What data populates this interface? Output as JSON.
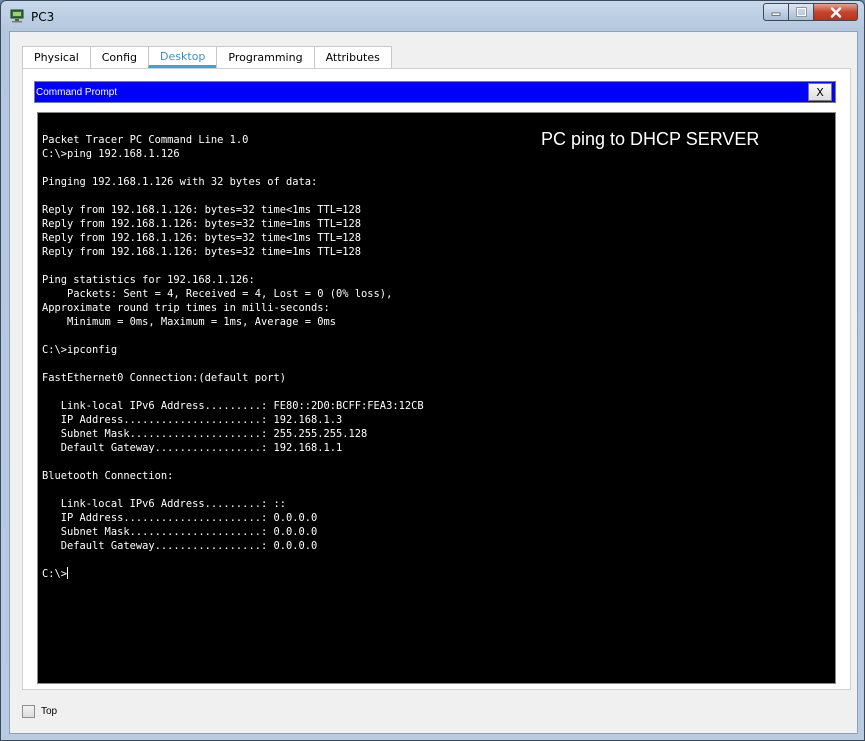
{
  "window": {
    "title": "PC3"
  },
  "tabs": [
    {
      "label": "Physical"
    },
    {
      "label": "Config"
    },
    {
      "label": "Desktop",
      "active": true
    },
    {
      "label": "Programming"
    },
    {
      "label": "Attributes"
    }
  ],
  "command_prompt": {
    "title": "Command Prompt",
    "close_label": "X",
    "annotation": "PC ping to DHCP SERVER",
    "prompt": "C:\\>",
    "lines": [
      "Packet Tracer PC Command Line 1.0",
      "C:\\>ping 192.168.1.126",
      "",
      "Pinging 192.168.1.126 with 32 bytes of data:",
      "",
      "Reply from 192.168.1.126: bytes=32 time<1ms TTL=128",
      "Reply from 192.168.1.126: bytes=32 time=1ms TTL=128",
      "Reply from 192.168.1.126: bytes=32 time<1ms TTL=128",
      "Reply from 192.168.1.126: bytes=32 time=1ms TTL=128",
      "",
      "Ping statistics for 192.168.1.126:",
      "    Packets: Sent = 4, Received = 4, Lost = 0 (0% loss),",
      "Approximate round trip times in milli-seconds:",
      "    Minimum = 0ms, Maximum = 1ms, Average = 0ms",
      "",
      "C:\\>ipconfig",
      "",
      "FastEthernet0 Connection:(default port)",
      "",
      "   Link-local IPv6 Address.........: FE80::2D0:BCFF:FEA3:12CB",
      "   IP Address......................: 192.168.1.3",
      "   Subnet Mask.....................: 255.255.255.128",
      "   Default Gateway.................: 192.168.1.1",
      "",
      "Bluetooth Connection:",
      "",
      "   Link-local IPv6 Address.........: ::",
      "   IP Address......................: 0.0.0.0",
      "   Subnet Mask.....................: 0.0.0.0",
      "   Default Gateway.................: 0.0.0.0",
      ""
    ]
  },
  "footer": {
    "top_label": "Top",
    "top_checked": false
  }
}
